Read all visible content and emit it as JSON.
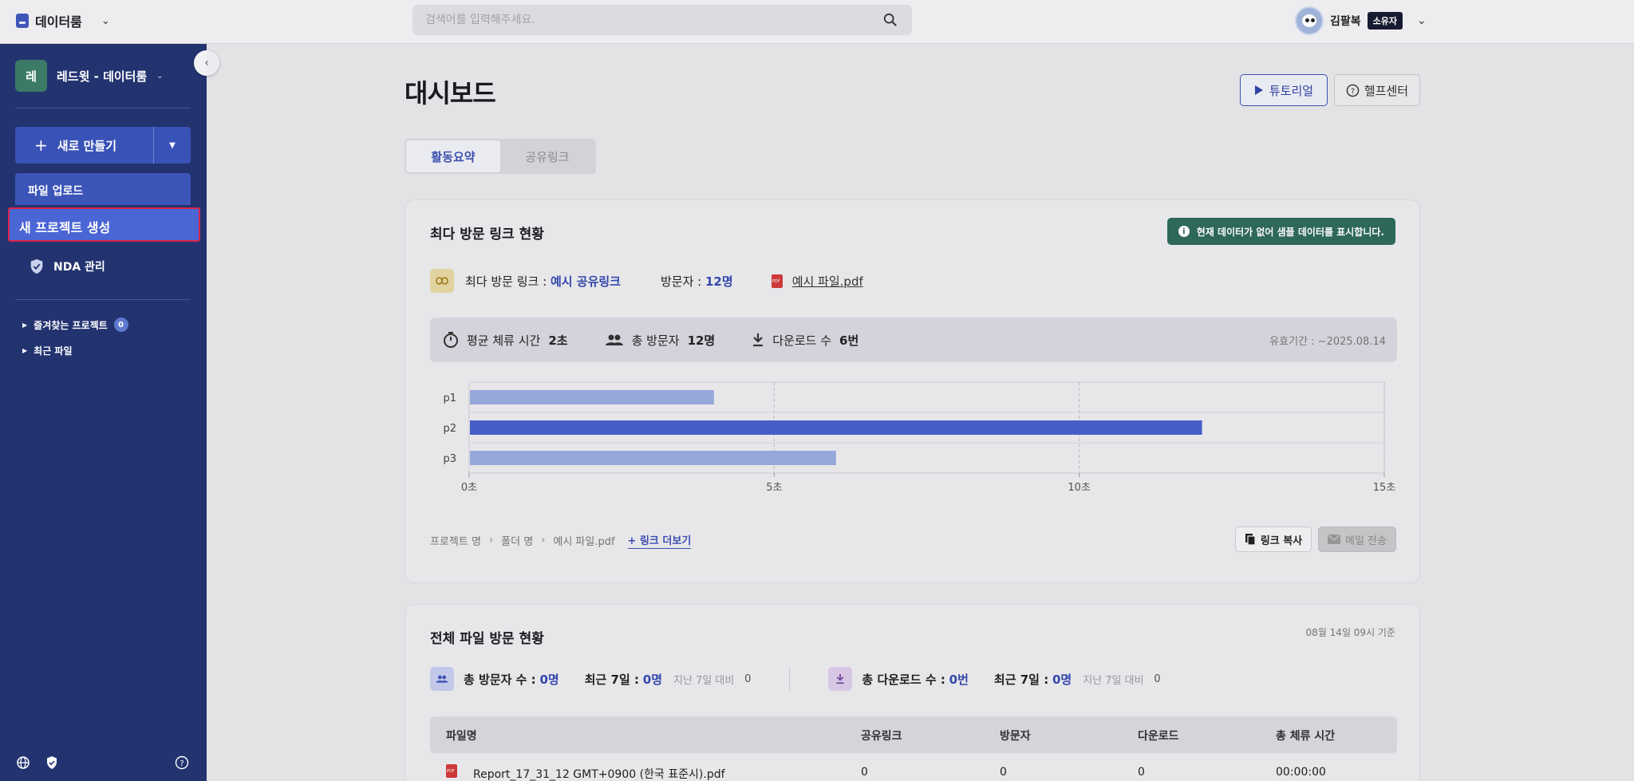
{
  "app": {
    "name": "데이터룸",
    "search_placeholder": "검색어를 입력해주세요.",
    "user_name": "김팔복",
    "user_role": "소유자"
  },
  "sidebar": {
    "workspace_badge": "레",
    "workspace_name": "레드윗 - 데이터룸",
    "new_button": "새로 만들기",
    "menu_upload": "파일 업로드",
    "menu_new_project": "새 프로젝트 생성",
    "nda": "NDA 관리",
    "favorites": "즐겨찾는 프로젝트",
    "favorites_count": "0",
    "recent": "최근 파일"
  },
  "header": {
    "title": "대시보드",
    "tutorial": "튜토리얼",
    "help": "헬프센터"
  },
  "tabs": [
    {
      "label": "활동요약",
      "active": true
    },
    {
      "label": "공유링크",
      "active": false
    }
  ],
  "top_links": {
    "title": "최다 방문 링크 현황",
    "notice": "현재 데이터가 없어 샘플 데이터를 표시합니다.",
    "top_link_label": "최다 방문 링크 :",
    "top_link_value": "예시 공유링크",
    "visitor_label": "방문자 :",
    "visitor_value": "12명",
    "file_name": "예시 파일.pdf",
    "avg_time_label": "평균 체류 시간",
    "avg_time_value": "2초",
    "total_visitors_label": "총 방문자",
    "total_visitors_value": "12명",
    "downloads_label": "다운로드 수",
    "downloads_value": "6번",
    "valid_until": "유효기간 : ~2025.08.14",
    "breadcrumb": [
      "프로젝트 명",
      "폴더 명",
      "예시 파일.pdf"
    ],
    "more_links": "+ 링크 더보기",
    "copy_link": "링크 복사",
    "send_mail": "메일 전송"
  },
  "chart_data": {
    "type": "bar",
    "orientation": "horizontal",
    "categories": [
      "p1",
      "p2",
      "p3"
    ],
    "values": [
      4,
      12,
      6
    ],
    "highlight_index": 1,
    "xlim": [
      0,
      15
    ],
    "x_ticks": [
      "0초",
      "5초",
      "10초",
      "15초"
    ],
    "x_tick_values": [
      0,
      5,
      10,
      15
    ],
    "colors": {
      "normal": "#9aabde",
      "highlight": "#4760cb"
    }
  },
  "file_visits": {
    "title": "전체 파일 방문 현황",
    "as_of": "08월 14일 09시 기준",
    "total_visitors_label": "총 방문자 수 :",
    "total_visitors_value": "0명",
    "recent7_label": "최근 7일 :",
    "recent7_visitors": "0명",
    "prev7_label": "지난 7일 대비",
    "prev7_visitors": "0",
    "total_downloads_label": "총 다운로드 수 :",
    "total_downloads_value": "0번",
    "recent7_downloads": "0명",
    "prev7_downloads": "0",
    "columns": [
      "파일명",
      "공유링크",
      "방문자",
      "다운로드",
      "총 체류 시간"
    ],
    "rows": [
      {
        "file": "Report_17_31_12 GMT+0900 (한국 표준시).pdf",
        "links": "0",
        "visitors": "0",
        "downloads": "0",
        "time": "00:00:00"
      }
    ]
  }
}
